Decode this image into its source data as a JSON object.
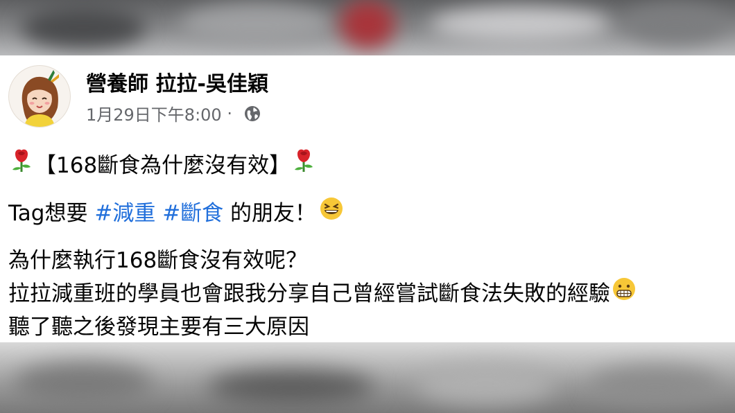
{
  "post": {
    "author": "營養師 拉拉-吳佳穎",
    "timestamp": "1月29日下午8:00",
    "separator": " · ",
    "privacy_icon": "globe-icon",
    "title_bracket_text": "【168斷食為什麼沒有效】",
    "title_emoji": "rose-emoji",
    "tag_line": {
      "prefix": "Tag想要 ",
      "hashtag1": "#減重",
      "space": " ",
      "hashtag2": "#斷食",
      "suffix": " 的朋友！",
      "emoji": "grinning-squinting-face-emoji"
    },
    "body_lines": [
      "為什麼執行168斷食沒有效呢？",
      "拉拉減重班的學員也會跟我分享自己曾經嘗試斷食法失敗的經驗",
      "聽了聽之後發現主要有三大原因"
    ],
    "body_line2_emoji": "grimacing-face-emoji"
  },
  "colors": {
    "hashtag": "#216fdb",
    "meta_text": "#65676b",
    "text": "#050505"
  }
}
